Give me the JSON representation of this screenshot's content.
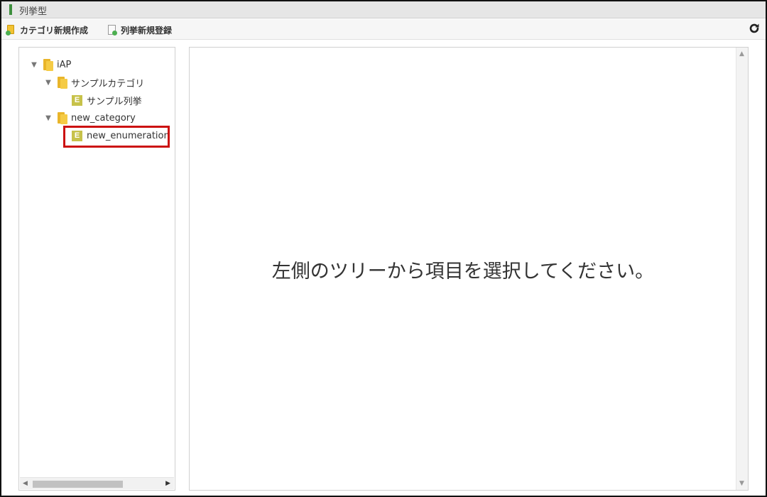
{
  "window": {
    "title": "列挙型"
  },
  "toolbar": {
    "new_category_label": "カテゴリ新規作成",
    "new_enum_label": "列挙新規登録",
    "refresh_icon": "refresh-icon"
  },
  "tree": {
    "nodes": [
      {
        "label": "iAP",
        "type": "folder",
        "expanded": true
      },
      {
        "label": "サンプルカテゴリ",
        "type": "folder",
        "expanded": true
      },
      {
        "label": "サンプル列挙",
        "type": "enumeration"
      },
      {
        "label": "new_category",
        "type": "folder",
        "expanded": true
      },
      {
        "label": "new_enumeration",
        "type": "enumeration",
        "highlighted": true
      }
    ],
    "enum_badge": "E"
  },
  "main": {
    "message": "左側のツリーから項目を選択してください。"
  },
  "colors": {
    "highlight": "#cc1111",
    "folder": "#f5cb45",
    "enum_badge": "#c7c24a",
    "title_bar_accent": "#3e8f3e"
  }
}
